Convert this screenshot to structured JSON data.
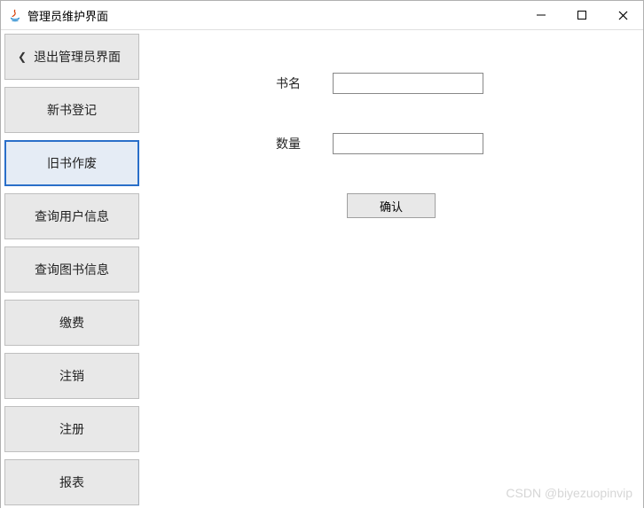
{
  "window": {
    "title": "管理员维护界面"
  },
  "sidebar": {
    "items": [
      {
        "label": "退出管理员界面",
        "has_back": true,
        "selected": false
      },
      {
        "label": "新书登记",
        "has_back": false,
        "selected": false
      },
      {
        "label": "旧书作废",
        "has_back": false,
        "selected": true
      },
      {
        "label": "查询用户信息",
        "has_back": false,
        "selected": false
      },
      {
        "label": "查询图书信息",
        "has_back": false,
        "selected": false
      },
      {
        "label": "缴费",
        "has_back": false,
        "selected": false
      },
      {
        "label": "注销",
        "has_back": false,
        "selected": false
      },
      {
        "label": "注册",
        "has_back": false,
        "selected": false
      },
      {
        "label": "报表",
        "has_back": false,
        "selected": false
      }
    ]
  },
  "form": {
    "book_name_label": "书名",
    "book_name_value": "",
    "quantity_label": "数量",
    "quantity_value": "",
    "confirm_label": "确认"
  },
  "watermark": "CSDN @biyezuopinvip"
}
